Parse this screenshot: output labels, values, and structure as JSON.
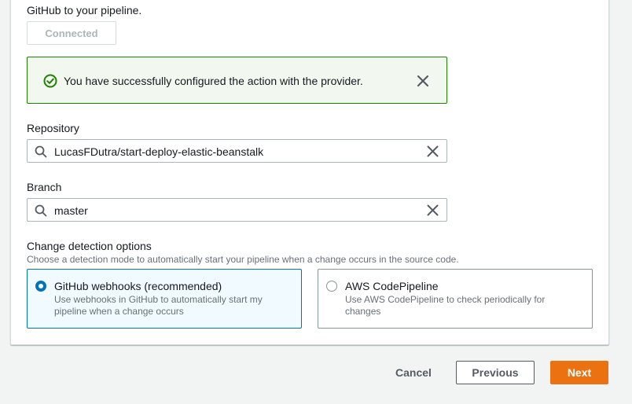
{
  "source": {
    "intro_text": "GitHub to your pipeline.",
    "connected_label": "Connected"
  },
  "flash": {
    "message": "You have successfully configured the action with the provider.",
    "status_color": "#1d8102",
    "icons": [
      "check-circle-icon",
      "close-icon"
    ]
  },
  "repository": {
    "label": "Repository",
    "value": "LucasFDutra/start-deploy-elastic-beanstalk",
    "icons": [
      "search-icon",
      "clear-icon"
    ]
  },
  "branch": {
    "label": "Branch",
    "value": "master",
    "icons": [
      "search-icon",
      "clear-icon"
    ]
  },
  "change_detection": {
    "label": "Change detection options",
    "description": "Choose a detection mode to automatically start your pipeline when a change occurs in the source code.",
    "selected": "github_webhooks",
    "options": [
      {
        "id": "github_webhooks",
        "title": "GitHub webhooks (recommended)",
        "description": "Use webhooks in GitHub to automatically start my pipeline when a change occurs"
      },
      {
        "id": "aws_codepipeline",
        "title": "AWS CodePipeline",
        "description": "Use AWS CodePipeline to check periodically for changes"
      }
    ]
  },
  "footer": {
    "cancel_label": "Cancel",
    "previous_label": "Previous",
    "next_label": "Next",
    "accent_color": "#ec7211"
  }
}
